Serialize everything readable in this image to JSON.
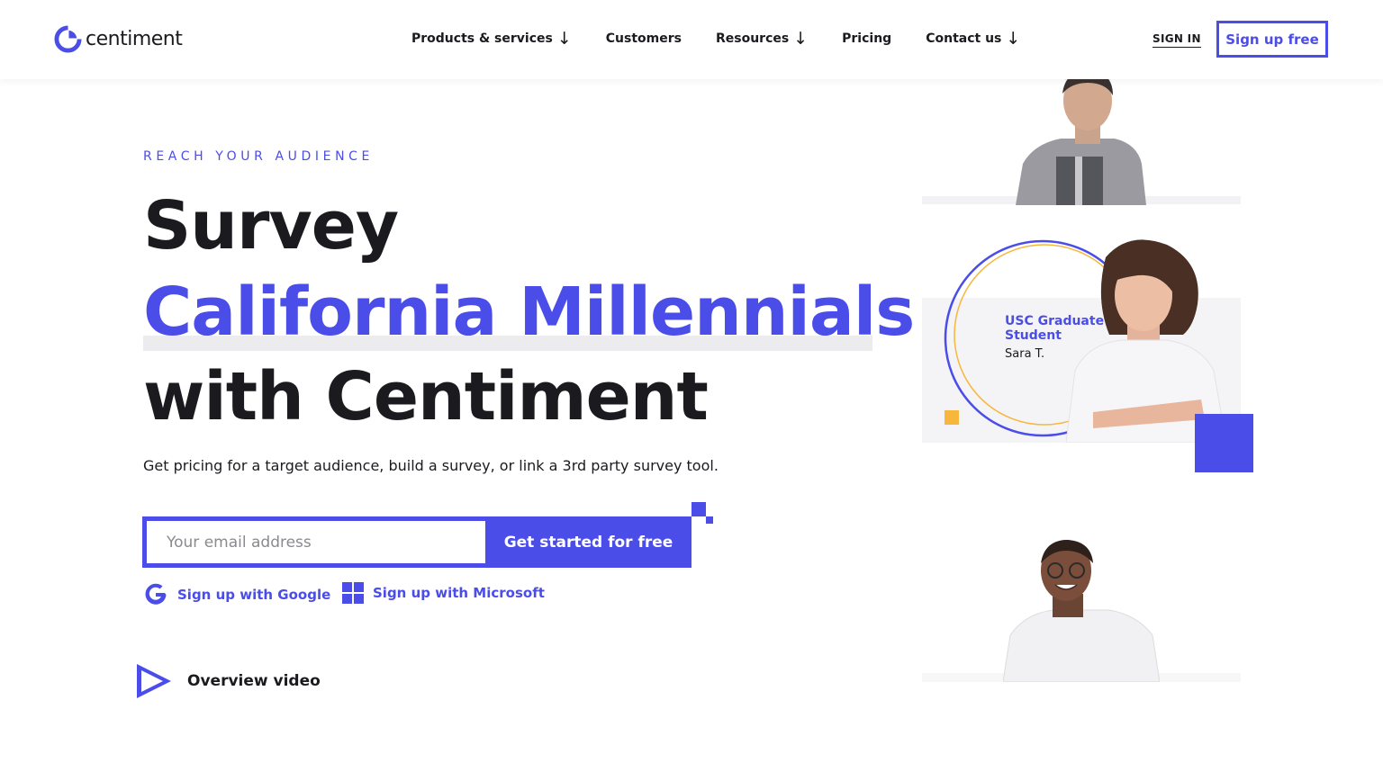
{
  "brand": {
    "name": "centiment",
    "accent": "#4b4de9",
    "yellow": "#f6b73c"
  },
  "nav": {
    "items": [
      {
        "label": "Products & services",
        "has_dropdown": true
      },
      {
        "label": "Customers",
        "has_dropdown": false
      },
      {
        "label": "Resources",
        "has_dropdown": true
      },
      {
        "label": "Pricing",
        "has_dropdown": false
      },
      {
        "label": "Contact us",
        "has_dropdown": true
      }
    ],
    "dropdown_glyph": "↓",
    "sign_in": "SIGN IN",
    "sign_up": "Sign up free"
  },
  "hero": {
    "eyebrow": "REACH YOUR AUDIENCE",
    "line1": "Survey",
    "line2": "California Millennials",
    "line3": "with Centiment",
    "subtitle": "Get pricing for a target audience, build a survey, or link a 3rd party survey tool."
  },
  "form": {
    "email_placeholder": "Your email address",
    "cta": "Get started for free"
  },
  "oauth": {
    "google": "Sign up with Google",
    "microsoft": "Sign up with Microsoft"
  },
  "video": {
    "label": "Overview video"
  },
  "testimonial": {
    "title": "USC Graduate Student",
    "name": "Sara T."
  }
}
